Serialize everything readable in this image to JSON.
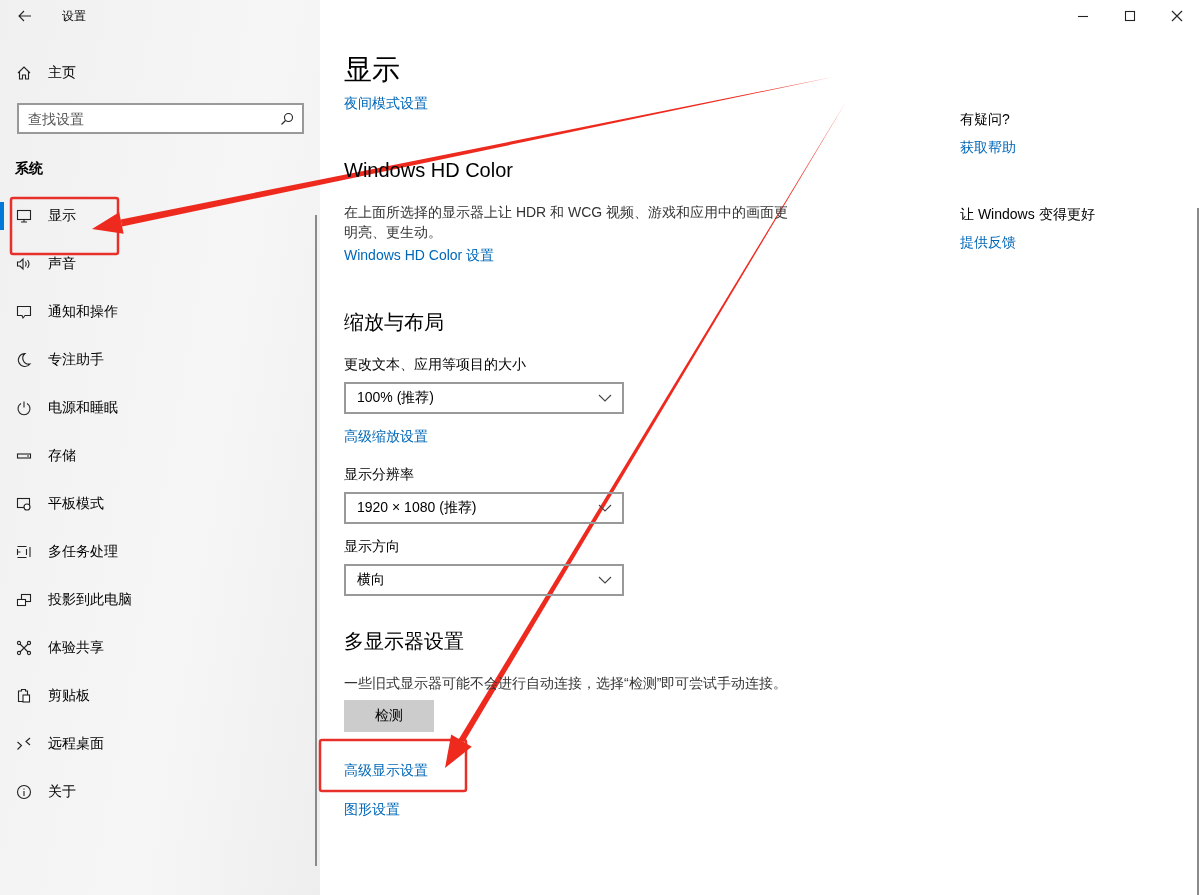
{
  "window": {
    "title": "设置"
  },
  "sidebar": {
    "home": "主页",
    "search": {
      "placeholder": "查找设置"
    },
    "section": "系统",
    "items": [
      {
        "label": "显示",
        "selected": true
      },
      {
        "label": "声音",
        "selected": false
      },
      {
        "label": "通知和操作",
        "selected": false
      },
      {
        "label": "专注助手",
        "selected": false
      },
      {
        "label": "电源和睡眠",
        "selected": false
      },
      {
        "label": "存储",
        "selected": false
      },
      {
        "label": "平板模式",
        "selected": false
      },
      {
        "label": "多任务处理",
        "selected": false
      },
      {
        "label": "投影到此电脑",
        "selected": false
      },
      {
        "label": "体验共享",
        "selected": false
      },
      {
        "label": "剪贴板",
        "selected": false
      },
      {
        "label": "远程桌面",
        "selected": false
      },
      {
        "label": "关于",
        "selected": false
      }
    ]
  },
  "main": {
    "title": "显示",
    "blocks": [
      {
        "kind": "link",
        "text": "夜间模式设置"
      },
      {
        "kind": "heading",
        "text": "Windows HD Color"
      },
      {
        "kind": "text",
        "text": "在上面所选择的显示器上让 HDR 和 WCG 视频、游戏和应用中的画面更明亮、更生动。"
      },
      {
        "kind": "link",
        "text": "Windows HD Color 设置"
      },
      {
        "kind": "heading",
        "text": "缩放与布局"
      },
      {
        "kind": "label",
        "text": "更改文本、应用等项目的大小"
      },
      {
        "kind": "dropdown",
        "text": "100% (推荐)"
      },
      {
        "kind": "link",
        "text": "高级缩放设置"
      },
      {
        "kind": "label",
        "text": "显示分辨率"
      },
      {
        "kind": "dropdown",
        "text": "1920 × 1080 (推荐)"
      },
      {
        "kind": "label",
        "text": "显示方向"
      },
      {
        "kind": "dropdown",
        "text": "横向"
      },
      {
        "kind": "heading",
        "text": "多显示器设置"
      },
      {
        "kind": "text",
        "text": "一些旧式显示器可能不会进行自动连接，选择“检测”即可尝试手动连接。"
      },
      {
        "kind": "button",
        "text": "检测"
      },
      {
        "kind": "link",
        "text": "高级显示设置"
      },
      {
        "kind": "link",
        "text": "图形设置"
      }
    ]
  },
  "aside": [
    {
      "heading": "有疑问?",
      "link": "获取帮助"
    },
    {
      "heading": "让 Windows 变得更好",
      "link": "提供反馈"
    }
  ]
}
